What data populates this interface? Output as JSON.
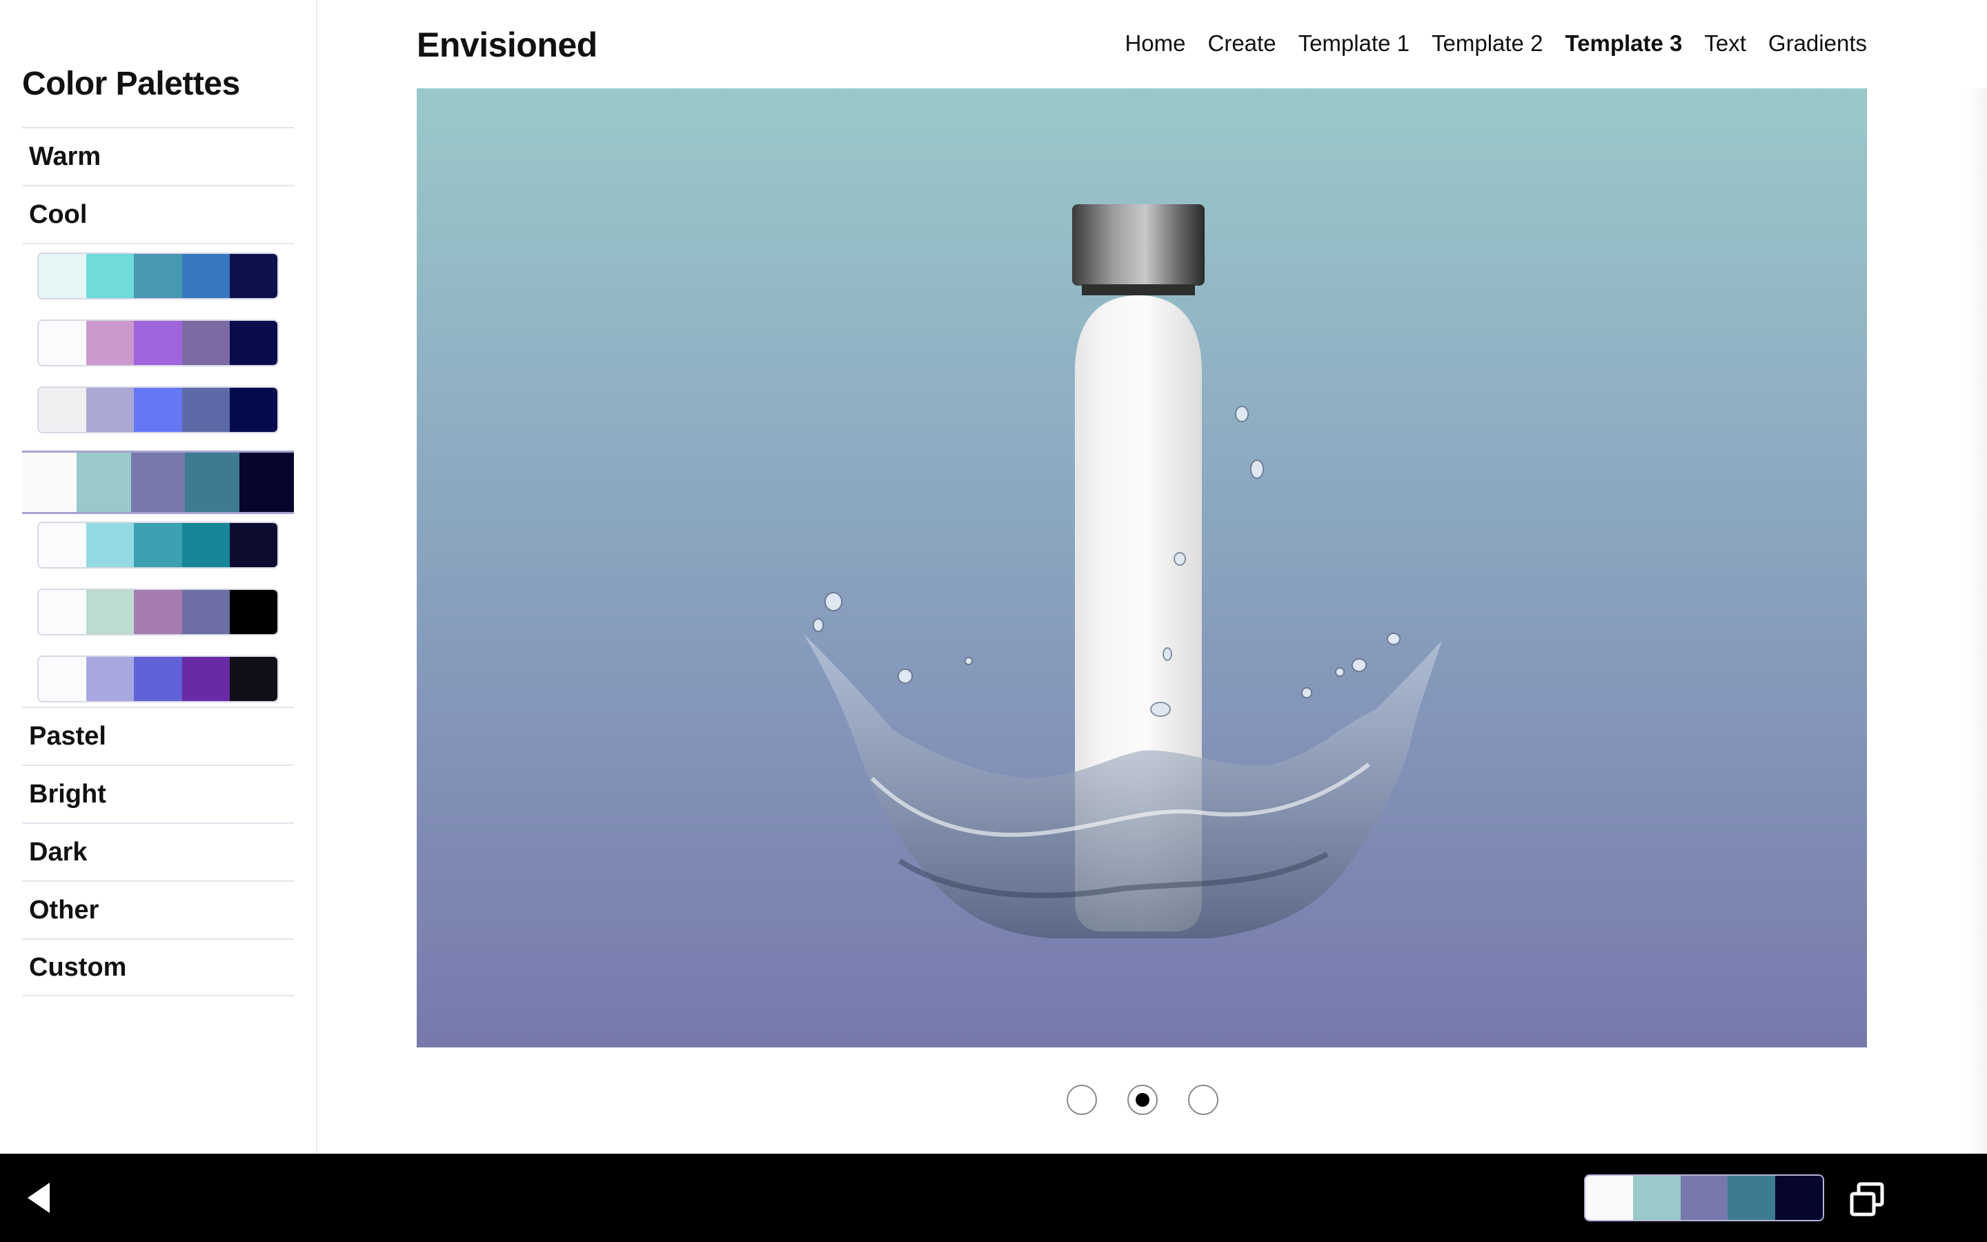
{
  "sidebar": {
    "title": "Color Palettes",
    "categories_top": [
      {
        "label": "Warm"
      },
      {
        "label": "Cool"
      }
    ],
    "categories_bottom": [
      {
        "label": "Pastel"
      },
      {
        "label": "Bright"
      },
      {
        "label": "Dark"
      },
      {
        "label": "Other"
      },
      {
        "label": "Custom"
      }
    ],
    "cool_palettes": [
      {
        "selected": false,
        "colors": [
          "#e4f7f4",
          "#70dcdc",
          "#4699b0",
          "#3878c0",
          "#0e124a"
        ]
      },
      {
        "selected": false,
        "colors": [
          "#fbfafd",
          "#cc98cd",
          "#a064dc",
          "#7c6aa4",
          "#0a0c4c"
        ]
      },
      {
        "selected": false,
        "colors": [
          "#f0f0f3",
          "#aaa8d2",
          "#6478f6",
          "#5e6aa8",
          "#060a4e"
        ]
      },
      {
        "selected": true,
        "colors": [
          "#fafafa",
          "#9ac9ca",
          "#7779ac",
          "#3e7b90",
          "#05052e"
        ]
      },
      {
        "selected": false,
        "colors": [
          "#fafbfd",
          "#94dae2",
          "#3aa0b2",
          "#168696",
          "#0c0c30"
        ]
      },
      {
        "selected": false,
        "colors": [
          "#fafbfd",
          "#bcdcd0",
          "#a67cb0",
          "#6c6ea4",
          "#000000"
        ]
      },
      {
        "selected": false,
        "colors": [
          "#fafbfd",
          "#a8a8e0",
          "#6262d8",
          "#6a2aa6",
          "#101018"
        ]
      }
    ]
  },
  "header": {
    "brand": "Envisioned",
    "nav": [
      {
        "label": "Home",
        "active": false
      },
      {
        "label": "Create",
        "active": false
      },
      {
        "label": "Template 1",
        "active": false
      },
      {
        "label": "Template 2",
        "active": false
      },
      {
        "label": "Template 3",
        "active": true
      },
      {
        "label": "Text",
        "active": false
      },
      {
        "label": "Gradients",
        "active": false
      }
    ]
  },
  "hero": {
    "gradient_top": "#9ac9ca",
    "gradient_bottom": "#7779ac",
    "image": "water-bottle-splash"
  },
  "carousel": {
    "slide_count": 3,
    "active_index": 1
  },
  "bottom_bar": {
    "back_icon": "back-triangle-icon",
    "window_icon": "window-switch-icon",
    "current_palette": [
      "#fafafa",
      "#9ac9ca",
      "#7779ac",
      "#3e7b90",
      "#05052e"
    ]
  }
}
